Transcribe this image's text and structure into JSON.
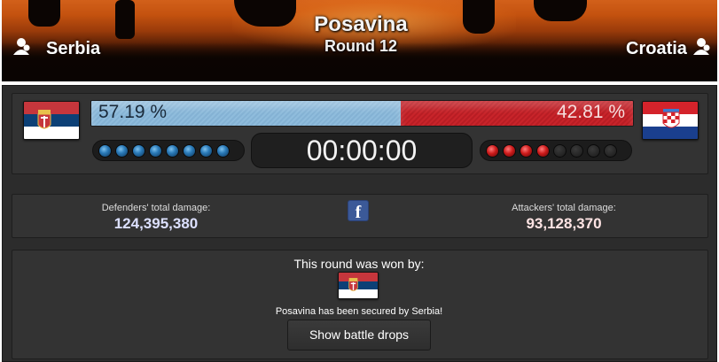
{
  "battle": {
    "region": "Posavina",
    "round": "Round 12"
  },
  "defender": {
    "name": "Serbia",
    "percent": "57.19 %",
    "percent_value": 57.19,
    "damage_label": "Defenders' total damage:",
    "damage": "124,395,380",
    "damage_color": "#dce0ff",
    "bar_color": "#8fbcdc",
    "wall_points_won": 8,
    "wall_points_total": 8
  },
  "attacker": {
    "name": "Croatia",
    "percent": "42.81 %",
    "percent_value": 42.81,
    "damage_label": "Attackers' total damage:",
    "damage": "93,128,370",
    "damage_color": "#ffe4e4",
    "bar_color": "#c8242a",
    "wall_points_won": 4,
    "wall_points_total": 8
  },
  "timer": "00:00:00",
  "social": {
    "icon": "facebook-icon",
    "glyph": "f"
  },
  "result": {
    "title": "This round was won by:",
    "winner_flag": "serbia-flag",
    "secured_text": "Posavina has been secured by Serbia!",
    "drops_button": "Show battle drops"
  }
}
